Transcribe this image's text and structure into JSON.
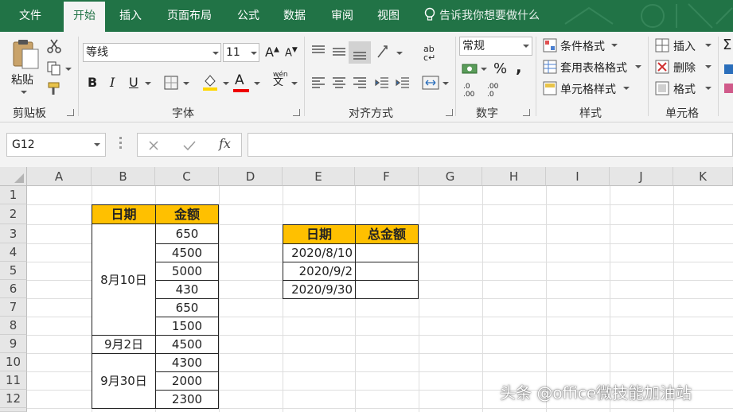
{
  "ribbon_tabs": [
    "文件",
    "开始",
    "插入",
    "页面布局",
    "公式",
    "数据",
    "审阅",
    "视图"
  ],
  "active_tab": "开始",
  "tell_me": "告诉我你想要做什么",
  "clipboard": {
    "paste_label": "粘贴",
    "group_label": "剪贴板"
  },
  "font": {
    "name": "等线",
    "size": "11",
    "bold": "B",
    "italic": "I",
    "underline": "U",
    "font_color_letter": "A",
    "phonetic": "wén",
    "group_label": "字体"
  },
  "alignment": {
    "group_label": "对齐方式"
  },
  "number": {
    "format": "常规",
    "percent": "%",
    "comma": ",",
    "inc_decimal_top": ".0",
    "inc_decimal_bottom": ".00",
    "dec_decimal_top": ".00",
    "dec_decimal_bottom": ".0",
    "group_label": "数字"
  },
  "styles": {
    "conditional": "条件格式",
    "table": "套用表格格式",
    "cell": "单元格样式",
    "group_label": "样式"
  },
  "cells": {
    "insert": "插入",
    "delete": "删除",
    "format": "格式",
    "group_label": "单元格"
  },
  "formula_bar": {
    "name_box": "G12",
    "fx": "fx",
    "value": ""
  },
  "columns": [
    "A",
    "B",
    "C",
    "D",
    "E",
    "F",
    "G",
    "H",
    "I",
    "J",
    "K"
  ],
  "rows": [
    "1",
    "2",
    "3",
    "4",
    "5",
    "6",
    "7",
    "8",
    "9",
    "10",
    "11",
    "12"
  ],
  "table1": {
    "header_date": "日期",
    "header_amount": "金额",
    "groups": [
      "8月10日",
      "9月2日",
      "9月30日"
    ],
    "amounts": [
      "650",
      "4500",
      "5000",
      "430",
      "650",
      "1500",
      "4500",
      "4300",
      "2000",
      "2300"
    ]
  },
  "table2": {
    "header_date": "日期",
    "header_total": "总金额",
    "dates": [
      "2020/8/10",
      "2020/9/2",
      "2020/9/30"
    ],
    "totals": [
      "",
      "",
      ""
    ]
  },
  "watermark": "头条 @office微技能加油站",
  "colors": {
    "excel_green": "#217346",
    "header_fill": "#ffc000"
  }
}
